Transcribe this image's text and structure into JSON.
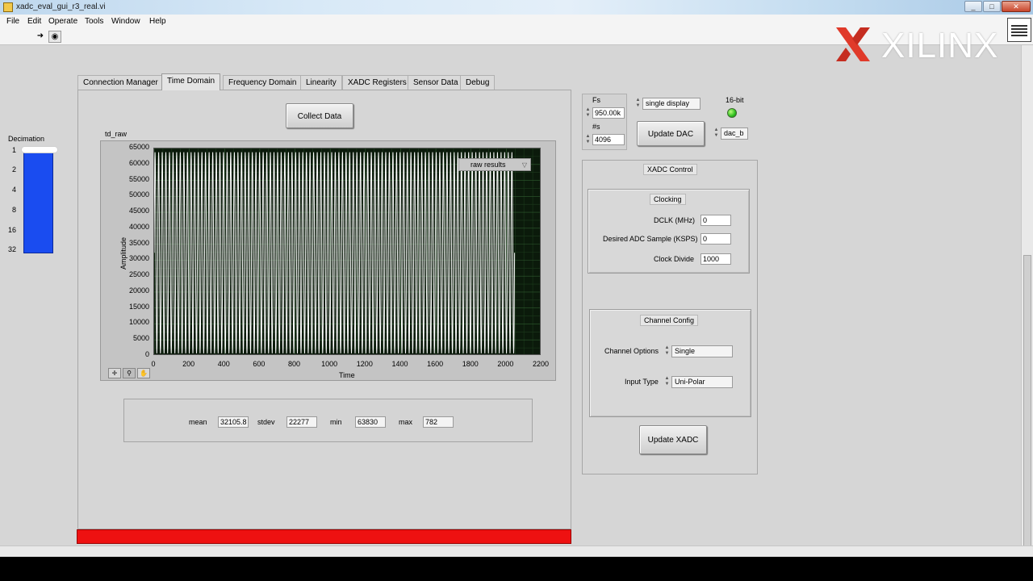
{
  "window": {
    "title": "xadc_eval_gui_r3_real.vi",
    "controls": [
      "_",
      "□",
      "✕"
    ]
  },
  "menu": [
    "File",
    "Edit",
    "Operate",
    "Tools",
    "Window",
    "Help"
  ],
  "toolbar": {
    "run_icon": "➜",
    "abort_icon": "◉"
  },
  "logo": {
    "text": "XILINX",
    "mark_color": "#e03a2a"
  },
  "decimation": {
    "label": "Decimation",
    "ticks": [
      "1",
      "2",
      "4",
      "8",
      "16",
      "32"
    ],
    "bar_color": "#1a4cf0"
  },
  "tabs": [
    "Connection Manager",
    "Time Domain",
    "Frequency Domain",
    "Linearity",
    "XADC Registers",
    "Sensor Data",
    "Debug"
  ],
  "active_tab": "Time Domain",
  "collect_button": "Collect Data",
  "graph": {
    "title": "td_raw",
    "legend": "raw results",
    "palette": [
      "✛",
      "⚲",
      "✋"
    ]
  },
  "chart_data": {
    "type": "line",
    "title": "td_raw",
    "xlabel": "Time",
    "ylabel": "Amplitude",
    "xlim": [
      0,
      2200
    ],
    "ylim": [
      0,
      65000
    ],
    "x_ticks": [
      "0",
      "200",
      "400",
      "600",
      "800",
      "1000",
      "1200",
      "1400",
      "1600",
      "1800",
      "2000",
      "2200"
    ],
    "y_ticks": [
      "65000",
      "60000",
      "55000",
      "50000",
      "45000",
      "40000",
      "35000",
      "30000",
      "25000",
      "20000",
      "15000",
      "10000",
      "5000",
      "0"
    ],
    "grid": true,
    "series": [
      {
        "name": "raw results",
        "color": "#ffffff",
        "samples": 2048,
        "cycles": 100,
        "min": 782,
        "max": 63830,
        "data_end": 2047
      }
    ]
  },
  "stats": {
    "mean_label": "mean",
    "mean": "32105.8",
    "stdev_label": "stdev",
    "stdev": "22277",
    "min_label": "min",
    "min": "63830",
    "max_label": "max",
    "max": "782"
  },
  "status_bar_color": "#ee1111",
  "sampling": {
    "fs_label": "Fs",
    "fs": "950.00k",
    "ns_label": "#s",
    "ns": "4096",
    "display_mode": "single display",
    "bit_label": "16-bit",
    "update_dac": "Update DAC",
    "dac_select": "dac_b"
  },
  "xadc": {
    "title": "XADC Control",
    "clocking_title": "Clocking",
    "dclk_label": "DCLK (MHz)",
    "dclk": "0",
    "sample_label": "Desired ADC Sample (KSPS)",
    "sample": "0",
    "divide_label": "Clock Divide",
    "divide": "1000",
    "channel_title": "Channel Config",
    "channel_options_label": "Channel Options",
    "channel_options": "Single",
    "input_type_label": "Input Type",
    "input_type": "Uni-Polar",
    "update_button": "Update XADC"
  }
}
